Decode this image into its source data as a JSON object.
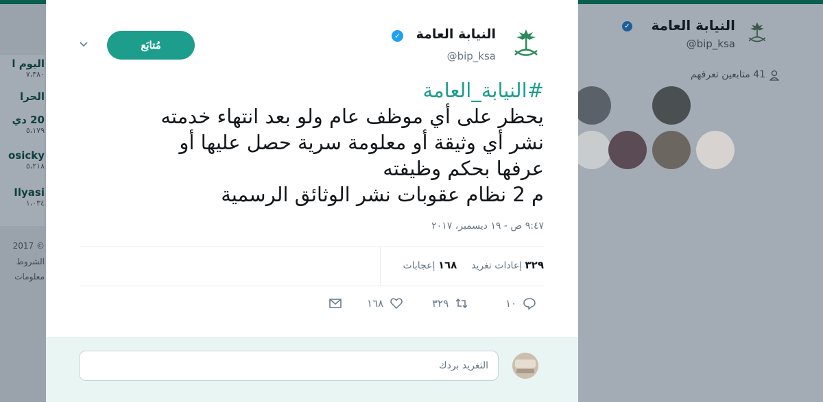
{
  "background": {
    "profile_name": "النيابة العامة",
    "profile_handle": "@bip_ksa",
    "followers_you_know": "41 متابعين تعرفهم",
    "trends": [
      {
        "title": "اليوم ا",
        "count": "٧،٣٨٠"
      },
      {
        "title": "الحرا"
      },
      {
        "title": "20 دي",
        "count": "٥،١٧٩"
      },
      {
        "title": "osicky",
        "count": "٥،٢١٨"
      },
      {
        "title": "Ilyasi",
        "count": "١،٠٣٤"
      }
    ],
    "footer": [
      "2017 ©",
      "الشروط",
      "معلومات"
    ]
  },
  "tweet": {
    "author_name": "النيابة العامة",
    "author_handle": "@bip_ksa",
    "follow_label": "مُتابَع",
    "hashtag": "#النيابة_العامة",
    "lines": [
      "يحظر على أي موظف عام ولو بعد انتهاء خدمته",
      "نشر أي وثيقة أو معلومة سرية حصل عليها أو",
      "عرفها بحكم وظيفته",
      "م 2 نظام عقوبات نشر الوثائق الرسمية"
    ],
    "timestamp": "٩:٤٧ ص - ١٩ ديسمبر، ٢٠١٧",
    "retweets_count": "٣٢٩",
    "retweets_label": "إعادات تغريد",
    "likes_count": "١٦٨",
    "likes_label": "إعجابات",
    "actions": {
      "replies": "١٠",
      "retweets": "٣٢٩",
      "likes": "١٦٨"
    }
  },
  "reply": {
    "placeholder": "التغريد بردك"
  },
  "colors": {
    "accent": "#1d9e8c",
    "verified": "#1da1f2",
    "text": "#14171a",
    "muted": "#657786"
  }
}
